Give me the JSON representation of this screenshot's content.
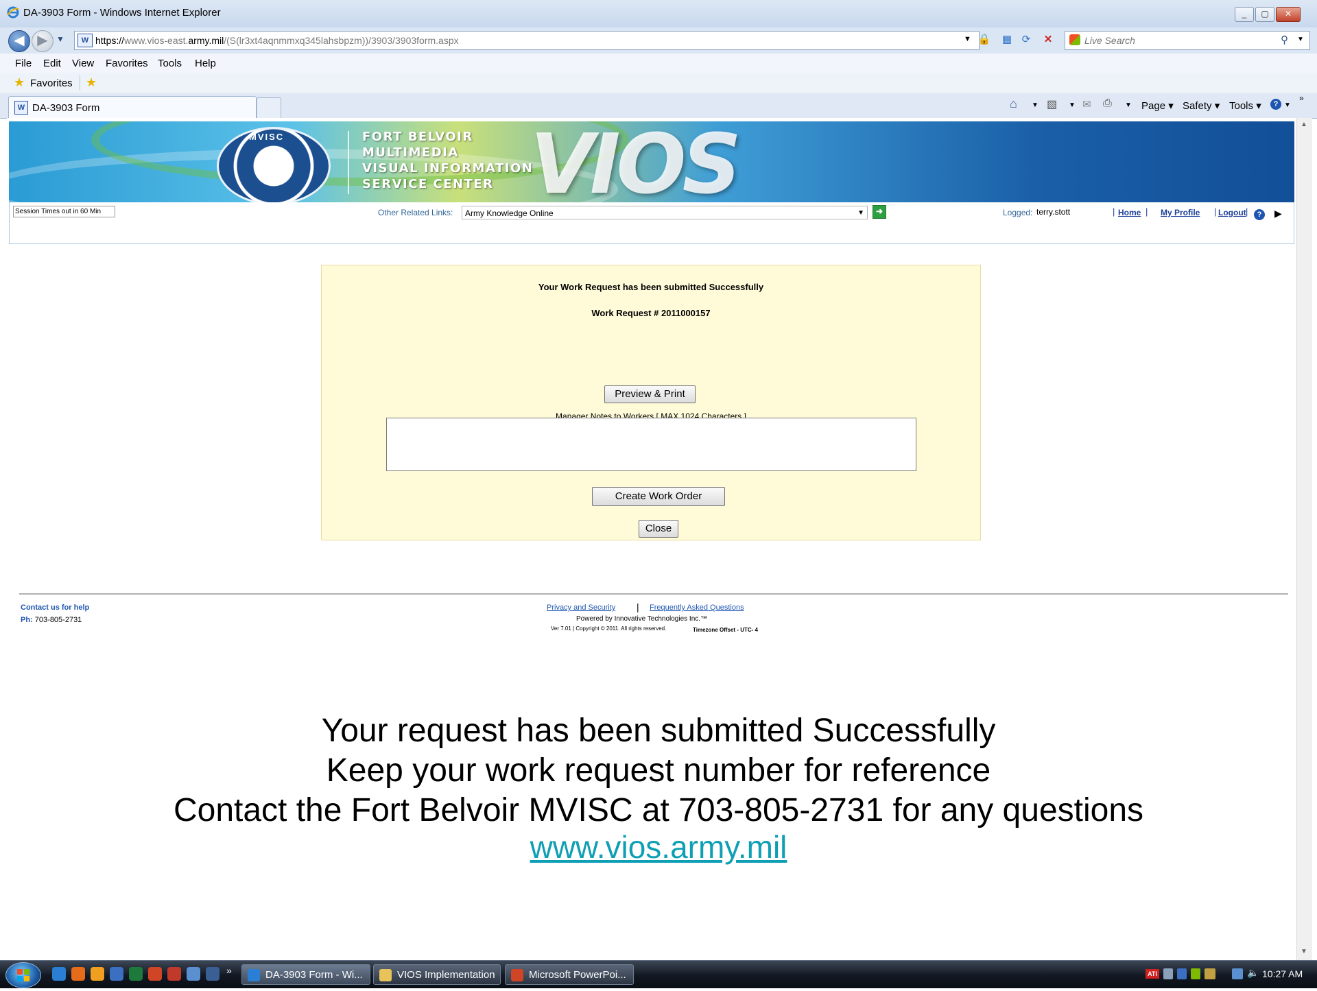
{
  "window": {
    "title": "DA-3903 Form - Windows Internet Explorer",
    "url_scheme": "https://",
    "url_host_pre": "www.vios-east.",
    "url_host_bold": "army.mil",
    "url_path": "/(S(lr3xt4aqnmmxq345lahsbpzm))/3903/3903form.aspx",
    "search_placeholder": "Live Search"
  },
  "menu": [
    "File",
    "Edit",
    "View",
    "Favorites",
    "Tools",
    "Help"
  ],
  "favorites_label": "Favorites",
  "tab": {
    "title": "DA-3903 Form"
  },
  "command_bar": {
    "page": "Page",
    "safety": "Safety",
    "tools": "Tools"
  },
  "banner": {
    "seal_text": "MVISC",
    "lines": [
      "FORT BELVOIR",
      "MULTIMEDIA",
      "VISUAL INFORMATION",
      "SERVICE CENTER"
    ],
    "logo": "VIOS"
  },
  "linkbar": {
    "session": "Session Times out in 60 Min",
    "other_links_label": "Other Related Links:",
    "other_links_selected": "Army Knowledge Online",
    "logged_label": "Logged:",
    "logged_user": "terry.stott",
    "home": "Home",
    "my_profile": "My Profile",
    "logout": "Logout"
  },
  "panel": {
    "success": "Your Work Request has been submitted Successfully",
    "request_number": "Work Request # 2011000157",
    "preview_print": "Preview & Print",
    "notes_label": "Manager Notes to Workers [ MAX 1024 Characters ]",
    "notes_value": "",
    "create_work_order": "Create Work Order",
    "close": "Close"
  },
  "footer": {
    "contact": "Contact us for help",
    "phone_label": "Ph:",
    "phone": "703-805-2731",
    "privacy": "Privacy and Security",
    "faq": "Frequently Asked Questions",
    "powered": "Powered by Innovative Technologies Inc.™",
    "version": "Ver 7.01 | Copyright © 2011. All rights reserved.",
    "timezone": "Timezone Offset - UTC- 4"
  },
  "caption": {
    "line1": "Your request has been submitted Successfully",
    "line2": "Keep your work request number for reference",
    "line3": "Contact the Fort Belvoir MVISC at 703-805-2731 for any questions",
    "link": " www.vios.army.mil"
  },
  "taskbar": {
    "tasks": [
      "DA-3903 Form - Wi...",
      "VIOS Implementation",
      "Microsoft PowerPoi..."
    ],
    "clock": "10:27 AM"
  },
  "colors": {
    "panel_bg": "#fffbd9",
    "link_blue": "#1d56b0",
    "caption_link": "#0f9fb4"
  }
}
